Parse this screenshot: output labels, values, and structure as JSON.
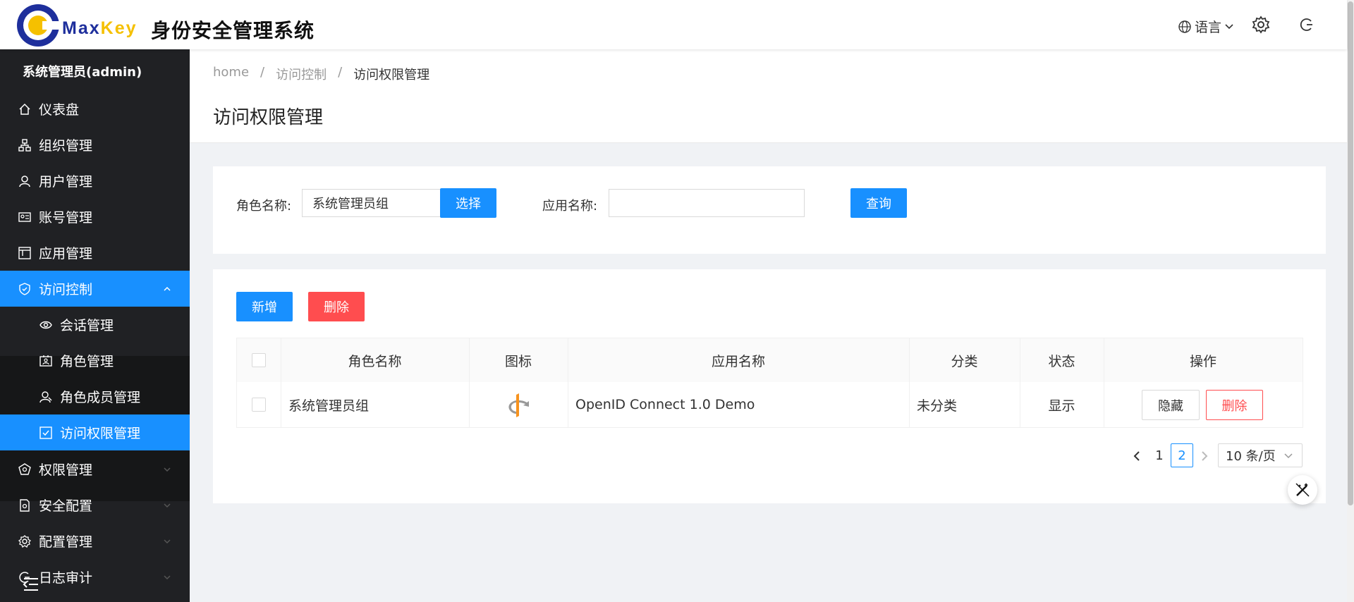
{
  "header": {
    "brand_max": "Max",
    "brand_key": "Key",
    "system_title": "身份安全管理系统",
    "language_label": "语言"
  },
  "sidebar": {
    "user": "系统管理员(admin)",
    "items": [
      {
        "label": "仪表盘",
        "icon": "home-icon"
      },
      {
        "label": "组织管理",
        "icon": "org-icon"
      },
      {
        "label": "用户管理",
        "icon": "user-icon"
      },
      {
        "label": "账号管理",
        "icon": "id-card-icon"
      },
      {
        "label": "应用管理",
        "icon": "app-icon"
      },
      {
        "label": "访问控制",
        "icon": "shield-icon"
      },
      {
        "label": "权限管理",
        "icon": "permission-icon"
      },
      {
        "label": "安全配置",
        "icon": "security-file-icon"
      },
      {
        "label": "配置管理",
        "icon": "gear-icon"
      },
      {
        "label": "日志审计",
        "icon": "audit-icon"
      }
    ],
    "subitems": [
      {
        "label": "会话管理",
        "icon": "eye-icon"
      },
      {
        "label": "角色管理",
        "icon": "role-icon"
      },
      {
        "label": "角色成员管理",
        "icon": "members-icon"
      },
      {
        "label": "访问权限管理",
        "icon": "check-square-icon"
      }
    ],
    "active_color": "#1890ff"
  },
  "breadcrumb": [
    "home",
    "访问控制",
    "访问权限管理"
  ],
  "breadcrumb_separator": "/",
  "page_title": "访问权限管理",
  "search": {
    "role_label": "角色名称:",
    "role_value": "系统管理员组",
    "select_button": "选择",
    "app_label": "应用名称:",
    "app_value": "",
    "query_button": "查询"
  },
  "actions": {
    "add": "新增",
    "delete": "删除"
  },
  "table": {
    "columns": [
      "角色名称",
      "图标",
      "应用名称",
      "分类",
      "状态",
      "操作"
    ],
    "rows": [
      {
        "role": "系统管理员组",
        "icon": "openid-icon",
        "app": "OpenID Connect 1.0 Demo",
        "category": "未分类",
        "status": "显示",
        "hide_button": "隐藏",
        "delete_button": "删除"
      }
    ]
  },
  "pagination": {
    "pages": [
      "1",
      "2"
    ],
    "current": "2",
    "page_size": "10 条/页"
  }
}
